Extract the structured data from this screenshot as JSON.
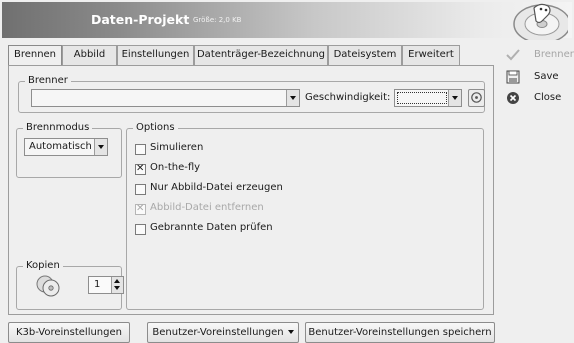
{
  "header": {
    "title": "Daten-Projekt",
    "subtitle": "Größe: 2,0 KB",
    "logo": "k3b-logo"
  },
  "tabs": [
    {
      "label": "Brennen",
      "active": true
    },
    {
      "label": "Abbild",
      "active": false
    },
    {
      "label": "Einstellungen",
      "active": false
    },
    {
      "label": "Datenträger-Bezeichnung",
      "active": false
    },
    {
      "label": "Dateisystem",
      "active": false
    },
    {
      "label": "Erweitert",
      "active": false
    }
  ],
  "brenner": {
    "legend": "Brenner",
    "device_value": "",
    "speed_label": "Geschwindigkeit:",
    "speed_value": "",
    "refresh_icon": "refresh-icon"
  },
  "brennmodus": {
    "legend": "Brennmodus",
    "value": "Automatisch"
  },
  "options": {
    "legend": "Options",
    "items": [
      {
        "label": "Simulieren",
        "checked": false,
        "disabled": false
      },
      {
        "label": "On-the-fly",
        "checked": true,
        "disabled": false
      },
      {
        "label": "Nur Abbild-Datei erzeugen",
        "checked": false,
        "disabled": false
      },
      {
        "label": "Abbild-Datei entfernen",
        "checked": true,
        "disabled": true
      },
      {
        "label": "Gebrannte Daten prüfen",
        "checked": false,
        "disabled": false
      }
    ]
  },
  "kopien": {
    "legend": "Kopien",
    "value": "1",
    "icon": "disc-copies-icon"
  },
  "bottom_buttons": {
    "k3b_defaults": "K3b-Voreinstellungen",
    "user_defaults": "Benutzer-Voreinstellungen",
    "save_user_defaults": "Benutzer-Voreinstellungen speichern"
  },
  "side_buttons": {
    "burn": {
      "label": "Brennen",
      "icon": "burn-icon",
      "disabled": true
    },
    "save": {
      "label": "Save",
      "icon": "save-icon",
      "disabled": false
    },
    "close": {
      "label": "Close",
      "icon": "close-icon",
      "disabled": false
    }
  }
}
